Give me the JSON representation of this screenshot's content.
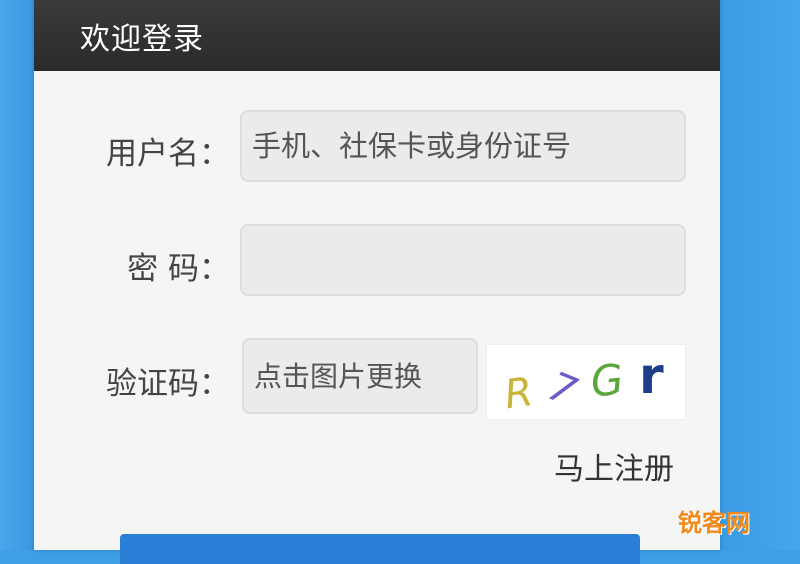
{
  "header": {
    "title": "欢迎登录"
  },
  "form": {
    "username": {
      "label": "用户名：",
      "placeholder": "手机、社保卡或身份证号",
      "value": ""
    },
    "password": {
      "label": "密 码：",
      "placeholder": "",
      "value": ""
    },
    "captcha": {
      "label": "验证码：",
      "placeholder": "点击图片更换",
      "value": "",
      "image_text": "R7Gr"
    },
    "register_link": "马上注册",
    "login_button": ""
  },
  "watermark": "锐客网",
  "colors": {
    "background": "#3f9ee6",
    "header": "#2f2f2f",
    "panel": "#f5f5f5",
    "input_bg": "#ebebeb",
    "button": "#2a7fd6",
    "watermark": "#f08a1a"
  },
  "icons": {
    "captcha": "captcha-image"
  }
}
